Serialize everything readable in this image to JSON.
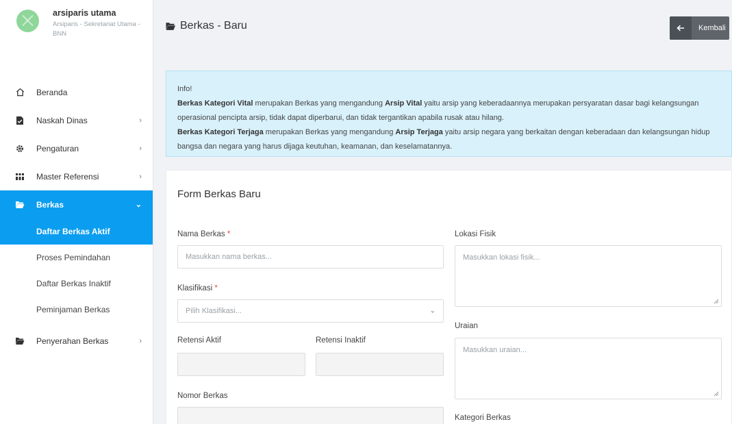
{
  "profile": {
    "name": "arsiparis utama",
    "role": "Arsiparis - Sekretariat Utama - BNN"
  },
  "menu": [
    {
      "label": "Beranda",
      "icon": "home-icon",
      "chevron": ""
    },
    {
      "label": "Naskah Dinas",
      "icon": "document-icon",
      "chevron": "›"
    },
    {
      "label": "Pengaturan",
      "icon": "gear-icon",
      "chevron": "›"
    },
    {
      "label": "Master Referensi",
      "icon": "grid-icon",
      "chevron": "›"
    },
    {
      "label": "Berkas",
      "icon": "folder-open-icon",
      "chevron": "⌄"
    },
    {
      "label": "Penyerahan Berkas",
      "icon": "folder-open-icon",
      "chevron": "›"
    }
  ],
  "submenu": [
    {
      "label": "Daftar Berkas Aktif"
    },
    {
      "label": "Proses Pemindahan"
    },
    {
      "label": "Daftar Berkas Inaktif"
    },
    {
      "label": "Peminjaman Berkas"
    }
  ],
  "header": {
    "title": "Berkas - Baru",
    "back_label": "Kembali"
  },
  "info": {
    "title": "Info!",
    "p1_strong1": "Berkas Kategori Vital",
    "p1_text1": " merupakan Berkas yang mengandung ",
    "p1_strong2": "Arsip Vital",
    "p1_text2": " yaitu arsip yang keberadaannya merupakan persyaratan dasar bagi kelangsungan operasional pencipta arsip, tidak dapat diperbarui, dan tidak tergantikan apabila rusak atau hilang.",
    "p2_strong1": "Berkas Kategori Terjaga",
    "p2_text1": " merupakan Berkas yang mengandung ",
    "p2_strong2": "Arsip Terjaga",
    "p2_text2": " yaitu arsip negara yang berkaitan dengan keberadaan dan kelangsungan hidup bangsa dan negara yang harus dijaga keutuhan, keamanan, dan keselamatannya."
  },
  "form": {
    "title": "Form Berkas Baru",
    "nama_label": "Nama Berkas",
    "nama_placeholder": "Masukkan nama berkas...",
    "klasifikasi_label": "Klasifikasi",
    "klasifikasi_placeholder": "Pilih Klasifikasi...",
    "retensi_aktif_label": "Retensi Aktif",
    "retensi_inaktif_label": "Retensi Inaktif",
    "nomor_label": "Nomor Berkas",
    "lokasi_label": "Lokasi Fisik",
    "lokasi_placeholder": "Masukkan lokasi fisik...",
    "uraian_label": "Uraian",
    "uraian_placeholder": "Masukkan uraian...",
    "kategori_label": "Kategori Berkas",
    "required_mark": "*"
  },
  "colors": {
    "accent": "#0b9df0",
    "info_bg": "#d9f1fb",
    "back_button": "#5e646a"
  }
}
